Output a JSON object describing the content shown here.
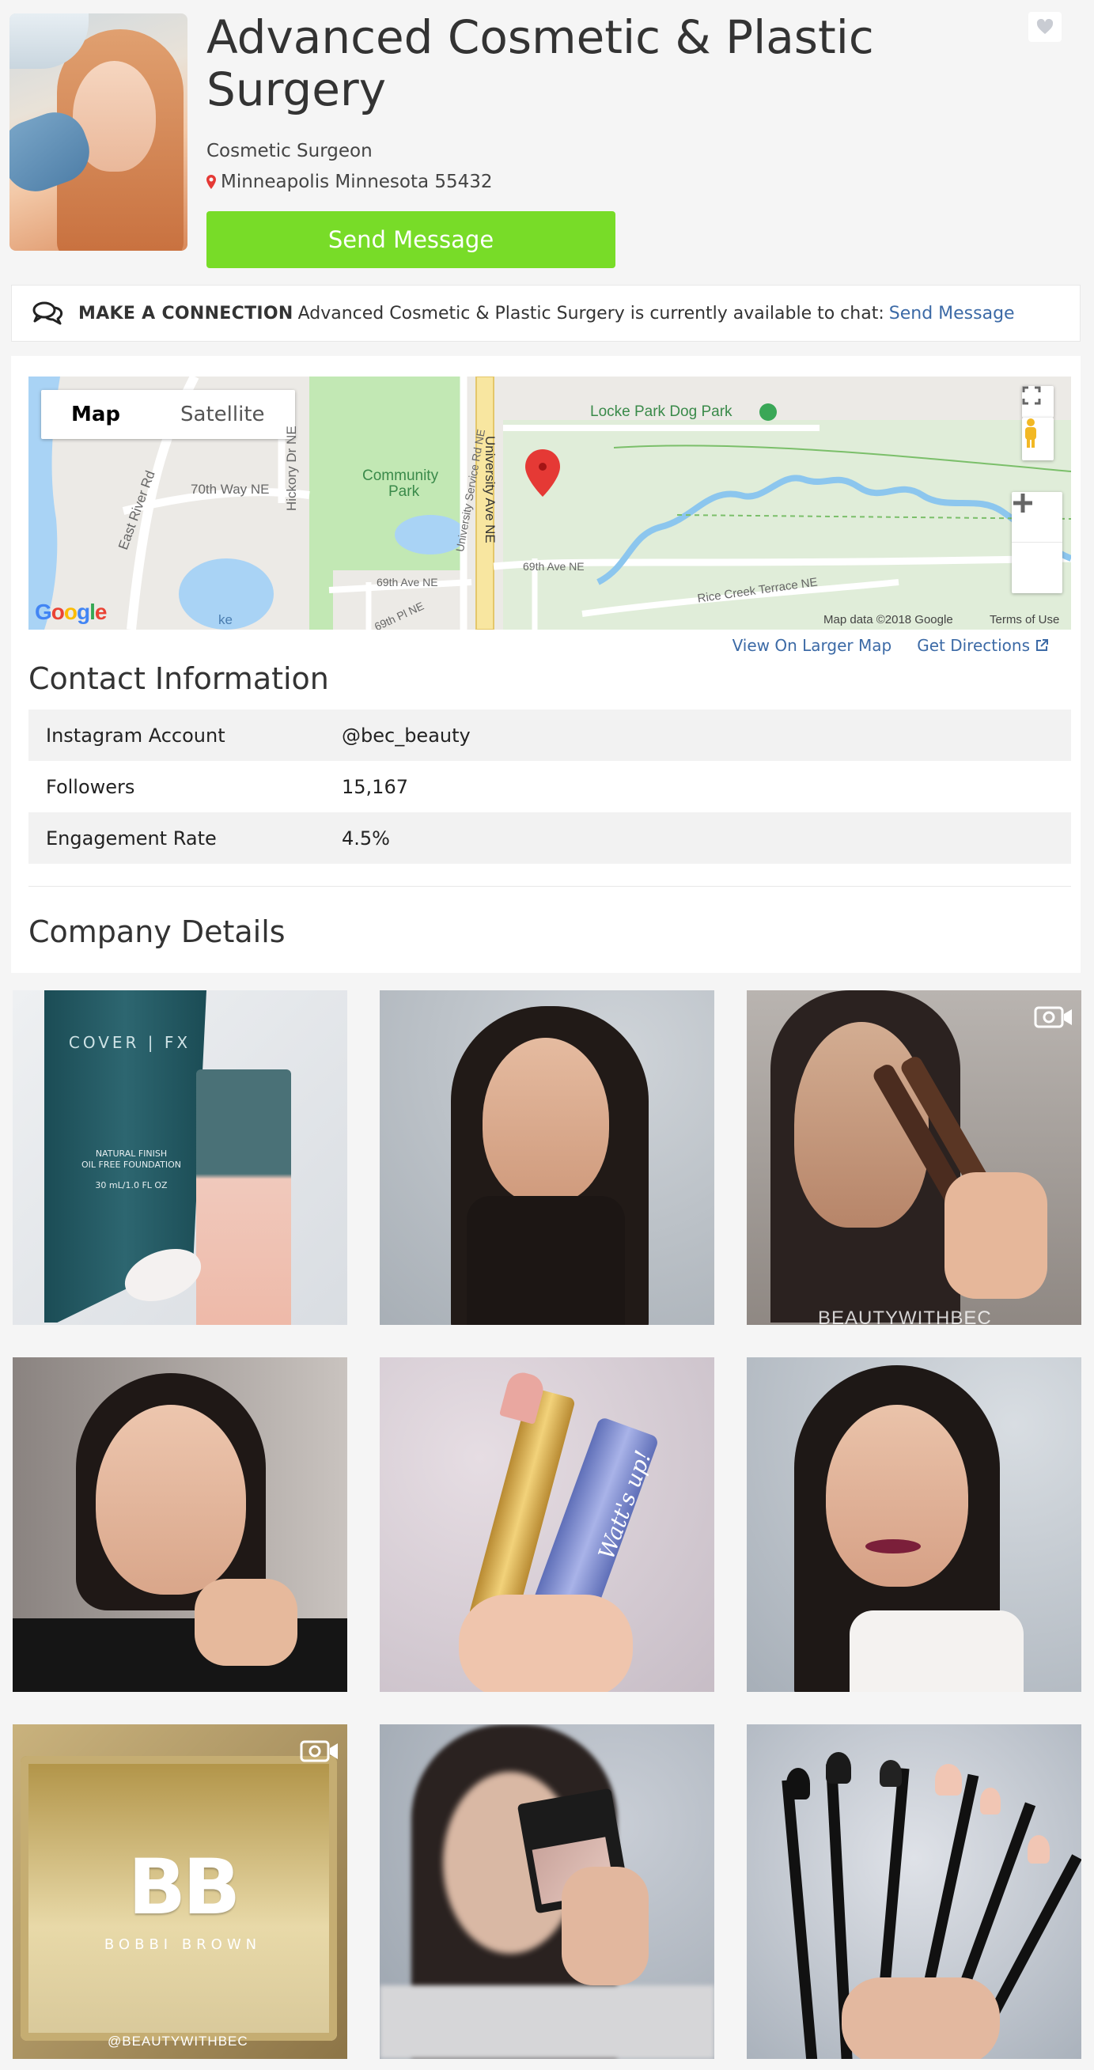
{
  "header": {
    "title": "Advanced Cosmetic & Plastic Surgery",
    "subtitle": "Cosmetic Surgeon",
    "location": "Minneapolis Minnesota 55432",
    "send_button": "Send Message"
  },
  "connection": {
    "heading": "MAKE A CONNECTION",
    "text": "Advanced Cosmetic & Plastic Surgery is currently available to chat:",
    "link": "Send Message"
  },
  "map": {
    "tab_map": "Map",
    "tab_satellite": "Satellite",
    "labels": {
      "park": "Locke Park Dog Park",
      "community": "Community",
      "community2": "Park",
      "way70": "70th Way NE",
      "east_river": "East River Rd",
      "hickory": "Hickory Dr NE",
      "univ_service": "University Service Rd NE",
      "univ_ave": "University Ave NE",
      "ave69a": "69th Ave NE",
      "ave69b": "69th Ave NE",
      "pl69": "69th Pl NE",
      "rice": "Rice Creek Terrace NE",
      "ke": "ke",
      "rice_v": "Rice",
      "ne1": "NE",
      "ne2": "Ric"
    },
    "copyright": "Map data ©2018 Google",
    "terms": "Terms of Use",
    "logo": "Google",
    "larger_link": "View On Larger Map",
    "directions_link": "Get Directions"
  },
  "contact": {
    "title": "Contact Information",
    "rows": [
      {
        "label": "Instagram Account",
        "value": "@bec_beauty"
      },
      {
        "label": "Followers",
        "value": "15,167"
      },
      {
        "label": "Engagement Rate",
        "value": "4.5%"
      }
    ]
  },
  "company": {
    "title": "Company Details"
  },
  "gallery": {
    "tile1_brand": "COVER | FX",
    "tile1_text1": "NATURAL FINISH",
    "tile1_text2": "OIL FREE FOUNDATION",
    "tile1_text3": "30 mL/1.0 FL OZ",
    "tile3_watermark": "BEAUTYWITHBEC",
    "tile5_text": "Watt's up!",
    "tile7_logo": "BB",
    "tile7_brand": "BOBBI BROWN",
    "tile7_watermark": "@BEAUTYWITHBEC"
  },
  "colors": {
    "accent_green": "#78dc28",
    "link_blue": "#3c6aa6",
    "pin_red": "#e53935"
  }
}
